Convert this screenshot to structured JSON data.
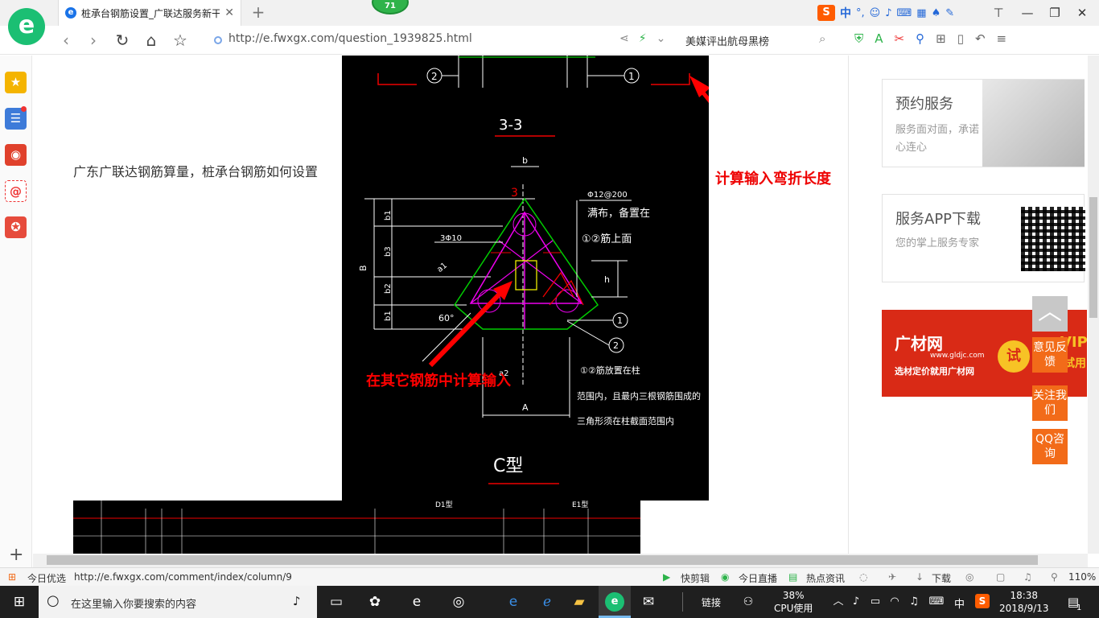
{
  "browser": {
    "tab_title": "桩承台钢筋设置_广联达服务新干",
    "notification_count": "71",
    "url": "http://e.fwxgx.com/question_1939825.html",
    "hot_search": "美媒评出航母黑榜",
    "ime_lang": "中"
  },
  "page": {
    "question_text": "广东广联达钢筋算量，桩承台钢筋如何设置",
    "annotation_top": "计算输入弯折长度",
    "annotation_bottom": "在其它钢筋中计算输入",
    "cad_labels": {
      "section": "3-3",
      "type": "C型",
      "dim_b": "b",
      "dim_B": "B",
      "dim_A": "A",
      "dim_h": "h",
      "b1": "b1",
      "b2": "b2",
      "b3": "b3",
      "a1": "a1",
      "a2": "a2",
      "angle": "60°",
      "rebar_top": "Φ12@200",
      "rebar_note1": "满布，备置在",
      "rebar_note2": "①②筋上面",
      "rebar_3": "3Φ10",
      "note_a": "①②筋放置在柱",
      "note_b": "范围内，且最内三根钢筋围成的",
      "note_c": "三角形须在柱截面范围内",
      "mark_1": "1",
      "mark_2": "2",
      "mark_3": "3",
      "table_d1": "D1型",
      "table_e1": "E1型"
    }
  },
  "sidebar_right": {
    "card1_title": "预约服务",
    "card1_sub": "服务面对面，承诺心连心",
    "card2_title": "服务APP下载",
    "card2_sub": "您的掌上服务专家",
    "ad_brand": "广材网",
    "ad_url": "www.gldjc.com",
    "ad_slogan": "选材定价就用广材网",
    "ad_try": "试",
    "ad_vip": "VIP",
    "ad_trial": "试用"
  },
  "float_buttons": {
    "feedback": "意见反馈",
    "follow": "关注我们",
    "qq": "QQ咨询"
  },
  "statusbar": {
    "today_pick": "今日优选",
    "hover_url": "http://e.fwxgx.com/comment/index/column/9",
    "quick_clip": "快剪辑",
    "live": "今日直播",
    "hot_news": "热点资讯",
    "download": "下载",
    "zoom": "110%"
  },
  "taskbar": {
    "search_placeholder": "在这里输入你要搜索的内容",
    "link_label": "链接",
    "cpu_percent": "38%",
    "cpu_label": "CPU使用",
    "ime": "中",
    "time": "18:38",
    "date": "2018/9/13",
    "notif_count": "1"
  }
}
